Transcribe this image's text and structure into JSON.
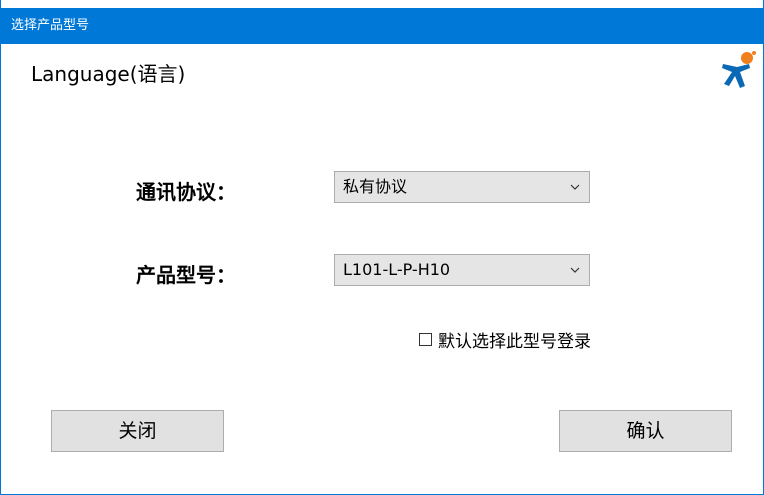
{
  "window": {
    "title": "选择产品型号"
  },
  "language_link": "Language(语言)",
  "logo": {
    "icon": "usr-person-logo-icon",
    "colors": {
      "head": "#f07f1e",
      "body": "#0a68b4"
    }
  },
  "form": {
    "protocol": {
      "label": "通讯协议：",
      "selected": "私有协议"
    },
    "model": {
      "label": "产品型号：",
      "selected": "L101-L-P-H10"
    },
    "remember": {
      "label": "默认选择此型号登录",
      "checked": false
    }
  },
  "buttons": {
    "close": "关闭",
    "confirm": "确认"
  },
  "colors": {
    "titlebar": "#0078d7",
    "button_bg": "#e1e1e1",
    "select_bg": "#e5e5e5"
  }
}
